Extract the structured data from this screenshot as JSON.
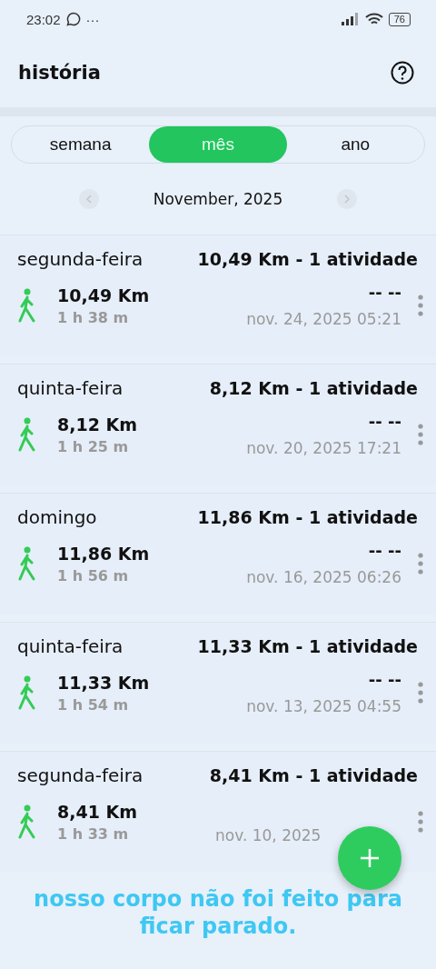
{
  "status_bar": {
    "time": "23:02",
    "more": "···",
    "battery": "76"
  },
  "header": {
    "title": "história"
  },
  "tabs": [
    {
      "label": "semana",
      "selected": false
    },
    {
      "label": "mês",
      "selected": true
    },
    {
      "label": "ano",
      "selected": false
    }
  ],
  "period": {
    "label": "November, 2025"
  },
  "days": [
    {
      "day": "segunda-feira",
      "summary": "10,49 Km - 1 atividade",
      "activities": [
        {
          "distance": "10,49 Km",
          "duration": "1 h 38 m",
          "pace": "-- --",
          "date": "nov. 24, 2025 05:21"
        }
      ]
    },
    {
      "day": "quinta-feira",
      "summary": "8,12 Km - 1 atividade",
      "activities": [
        {
          "distance": "8,12 Km",
          "duration": "1 h 25 m",
          "pace": "-- --",
          "date": "nov. 20, 2025 17:21"
        }
      ]
    },
    {
      "day": "domingo",
      "summary": "11,86 Km - 1 atividade",
      "activities": [
        {
          "distance": "11,86 Km",
          "duration": "1 h 56 m",
          "pace": "-- --",
          "date": "nov. 16, 2025 06:26"
        }
      ]
    },
    {
      "day": "quinta-feira",
      "summary": "11,33 Km - 1 atividade",
      "activities": [
        {
          "distance": "11,33 Km",
          "duration": "1 h 54 m",
          "pace": "-- --",
          "date": "nov. 13, 2025 04:55"
        }
      ]
    },
    {
      "day": "segunda-feira",
      "summary": "8,41 Km - 1 atividade",
      "activities": [
        {
          "distance": "8,41 Km",
          "duration": "1 h 33 m",
          "date": "nov. 10, 2025"
        }
      ]
    }
  ],
  "caption": "nosso corpo não foi feito para ficar parado."
}
